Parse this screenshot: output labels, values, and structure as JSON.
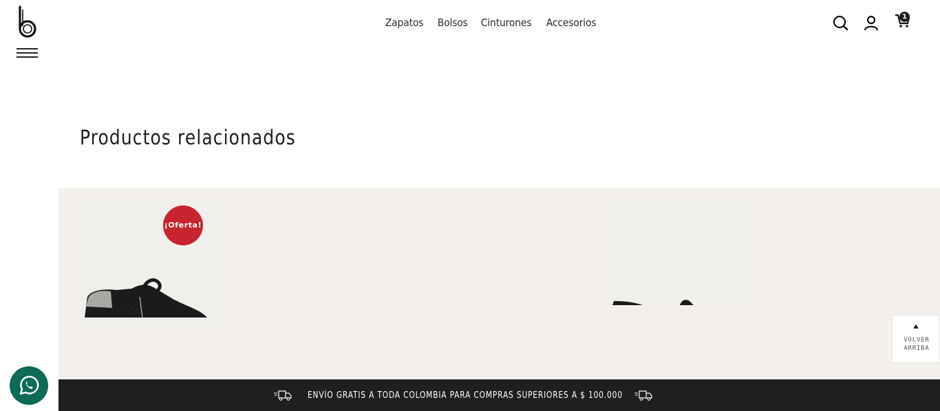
{
  "header": {
    "logo_icon": "brand-b-logo-icon",
    "menu_icon": "hamburger-icon",
    "nav": [
      "Zapatos",
      "Bolsos",
      "Cinturones",
      "Accesorios"
    ],
    "icons": [
      "search-icon",
      "user-icon",
      "cart-icon"
    ],
    "cart_count": "1"
  },
  "related": {
    "title": "Productos relacionados",
    "products": [
      {
        "badge": "¡Oferta!",
        "image": "black-perforated-sneaker-with-silver-heel"
      },
      {
        "image": "black-shoe-toe-partial"
      }
    ]
  },
  "back_to_top": {
    "line1": "VOLVER",
    "line2": "ARRIBA",
    "icon": "caret-up-icon"
  },
  "shipping_bar": {
    "text": "ENVÍO GRATIS A TODA COLOMBIA PARA COMPRAS SUPERIORES A $ 100.000",
    "icon": "delivery-truck-icon"
  },
  "whatsapp": {
    "icon": "whatsapp-icon"
  },
  "colors": {
    "carousel_bg": "#f3f0ec",
    "badge_red": "#c8242f",
    "bar_dark": "#1f1f1f",
    "whatsapp_green": "#0c6a57"
  }
}
